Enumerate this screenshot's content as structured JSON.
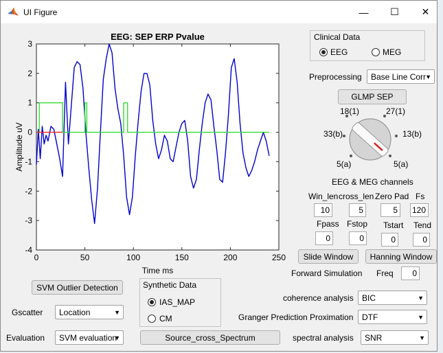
{
  "window": {
    "title": "UI Figure",
    "minimize": "—",
    "maximize": "☐",
    "close": "✕"
  },
  "chart_data": {
    "type": "line",
    "title": "EEG: SEP ERP Pvalue",
    "xlabel": "Time ms",
    "ylabel": "Amplitude uV",
    "xlim": [
      0,
      250
    ],
    "ylim": [
      -4,
      3
    ],
    "xticks": [
      "0",
      "50",
      "100",
      "150",
      "200",
      "250"
    ],
    "yticks": [
      "3",
      "2",
      "1",
      "0",
      "-1",
      "-2",
      "-3",
      "-4"
    ],
    "grid": false,
    "series": [
      {
        "color": "#0000cc",
        "x": [
          0,
          2,
          4,
          6,
          8,
          10,
          12,
          15,
          18,
          21,
          24,
          27,
          30,
          33,
          36,
          39,
          42,
          45,
          48,
          51,
          54,
          57,
          60,
          63,
          66,
          69,
          72,
          75,
          78,
          81,
          84,
          87,
          90,
          93,
          96,
          99,
          102,
          105,
          108,
          111,
          114,
          117,
          120,
          123,
          126,
          129,
          132,
          135,
          138,
          141,
          144,
          147,
          150,
          153,
          156,
          159,
          162,
          165,
          168,
          171,
          174,
          177,
          180,
          183,
          186,
          189,
          192,
          195,
          198,
          201,
          204,
          207,
          210,
          213,
          216,
          219,
          222,
          225,
          228,
          231,
          234,
          237,
          240
        ],
        "y": [
          -1.1,
          0.1,
          -0.9,
          0.2,
          -0.4,
          -0.1,
          -0.3,
          0.2,
          0.1,
          -0.4,
          -0.9,
          -1.5,
          1.7,
          -0.4,
          0.9,
          2.2,
          2.4,
          2.3,
          1.5,
          0.0,
          -1.2,
          -2.3,
          -3.1,
          -1.9,
          0.0,
          1.8,
          2.5,
          3.0,
          2.7,
          1.5,
          0.8,
          0.3,
          -0.8,
          -2.2,
          -2.8,
          -2.2,
          -0.8,
          0.4,
          1.4,
          2.0,
          2.0,
          1.6,
          0.4,
          -0.4,
          -0.9,
          -0.6,
          -0.1,
          -0.3,
          -0.9,
          -1.0,
          -0.5,
          0.0,
          0.3,
          0.4,
          -0.3,
          -1.5,
          -1.9,
          -1.6,
          -0.6,
          0.3,
          1.0,
          1.3,
          1.1,
          0.2,
          -0.6,
          -1.6,
          -1.7,
          -0.7,
          0.6,
          2.2,
          2.5,
          1.7,
          0.3,
          -0.7,
          -1.2,
          -1.5,
          -1.3,
          -1.0,
          -0.6,
          -0.3,
          0.0,
          -0.3,
          -0.8
        ]
      },
      {
        "color": "#33dd33",
        "x": [
          0,
          3,
          3,
          27,
          27,
          50,
          50,
          52,
          52,
          90,
          90,
          94,
          94,
          240
        ],
        "y": [
          0,
          0,
          1,
          1,
          0,
          0,
          1,
          1,
          0,
          0,
          1,
          1,
          0,
          0
        ]
      },
      {
        "color": "#ee2222",
        "x": [
          0,
          3,
          24,
          27
        ],
        "y": [
          0,
          0,
          0,
          0
        ]
      }
    ]
  },
  "clinical": {
    "title": "Clinical Data",
    "eeg": "EEG",
    "meg": "MEG",
    "selected": "EEG"
  },
  "preprocessing": {
    "label": "Preprocessing",
    "value": "Base Line Corr"
  },
  "glmp_button": "GLMP SEP",
  "knob": {
    "labels": {
      "tl": "18(1)",
      "tr": "27(1)",
      "l": "33(b)",
      "r": "13(b)",
      "bl": "5(a)",
      "br": "5(a)"
    }
  },
  "eeg_meg_title": "EEG & MEG channels",
  "params": {
    "win_len": {
      "label": "Win_len",
      "value": "10"
    },
    "cross_len": {
      "label": "cross_len",
      "value": "5"
    },
    "zero_pad": {
      "label": "Zero Pad",
      "value": "5"
    },
    "fs": {
      "label": "Fs",
      "value": "120"
    },
    "fpass": {
      "label": "Fpass",
      "value": "0"
    },
    "fstop": {
      "label": "Fstop",
      "value": "0"
    },
    "tstart": {
      "label": "Tstart",
      "value": "0"
    },
    "tend": {
      "label": "Tend",
      "value": "0"
    }
  },
  "slide_window": "Slide Window",
  "hanning_window": "Hanning Window",
  "forward_simulation": "Forward Simulation",
  "freq": {
    "label": "Freq",
    "value": "0"
  },
  "svm_outlier": "SVM Outlier Detection",
  "synthetic": {
    "title": "Synthetic Data",
    "ias": "IAS_MAP",
    "cm": "CM",
    "selected": "IAS_MAP"
  },
  "gscatter": {
    "label": "Gscatter",
    "value": "Location"
  },
  "evaluation": {
    "label": "Evaluation",
    "value": "SVM evaluation"
  },
  "source_cross": "Source_cross_Spectrum",
  "coherence": {
    "label": "coherence analysis",
    "value": "BIC"
  },
  "granger": {
    "label": "Granger Prediction Proximation",
    "value": "DTF"
  },
  "spectral": {
    "label": "spectral analysis",
    "value": "SNR"
  }
}
